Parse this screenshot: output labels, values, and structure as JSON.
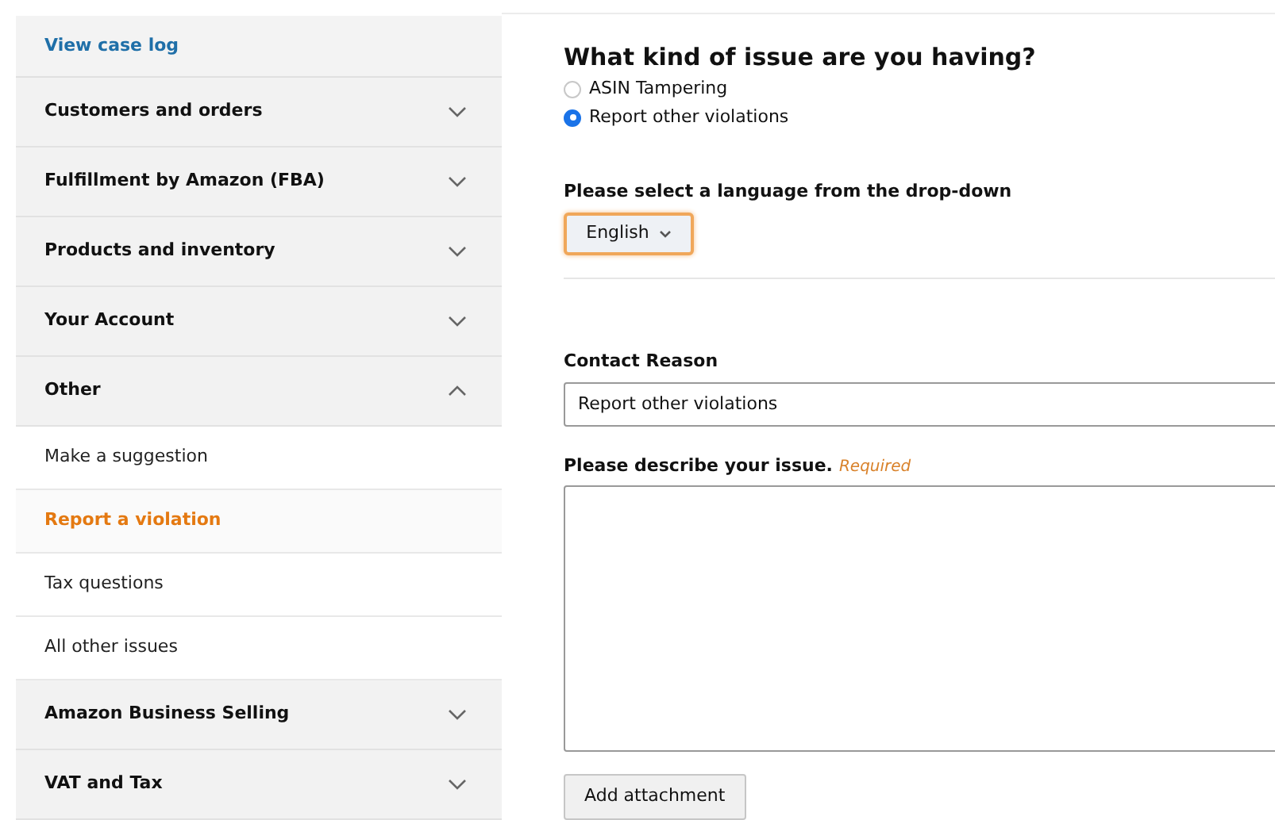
{
  "sidebar": {
    "items": [
      {
        "kind": "link",
        "label": "View case log"
      },
      {
        "kind": "section",
        "label": "Customers and orders",
        "expanded": false
      },
      {
        "kind": "section",
        "label": "Fulfillment by Amazon (FBA)",
        "expanded": false
      },
      {
        "kind": "section",
        "label": "Products and inventory",
        "expanded": false
      },
      {
        "kind": "section",
        "label": "Your Account",
        "expanded": false
      },
      {
        "kind": "section",
        "label": "Other",
        "expanded": true,
        "children": [
          {
            "label": "Make a suggestion",
            "selected": false
          },
          {
            "label": "Report a violation",
            "selected": true
          },
          {
            "label": "Tax questions",
            "selected": false
          },
          {
            "label": "All other issues",
            "selected": false
          }
        ]
      },
      {
        "kind": "section",
        "label": "Amazon Business Selling",
        "expanded": false
      },
      {
        "kind": "section",
        "label": "VAT and Tax",
        "expanded": false
      }
    ]
  },
  "form": {
    "question": "What kind of issue are you having?",
    "options": [
      {
        "label": "ASIN Tampering",
        "selected": false
      },
      {
        "label": "Report other violations",
        "selected": true
      }
    ],
    "language_label": "Please select a language from the drop-down",
    "language_value": "English",
    "contact_reason_label": "Contact Reason",
    "contact_reason_value": "Report other violations",
    "describe_label": "Please describe your issue.",
    "describe_required": "Required",
    "attachment_button": "Add attachment"
  }
}
